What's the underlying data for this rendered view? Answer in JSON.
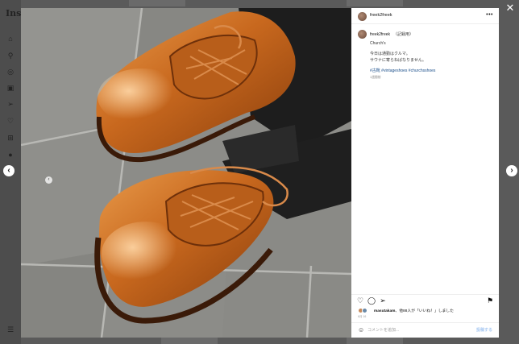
{
  "app": {
    "logo_text": "Insta"
  },
  "sidebar_icons": [
    "home-icon",
    "search-icon",
    "explore-icon",
    "reels-icon",
    "messages-icon",
    "notifications-icon",
    "create-icon",
    "profile-icon",
    "menu-icon"
  ],
  "nav": {
    "close": "✕",
    "prev": "‹",
    "next": "›"
  },
  "post": {
    "username": "freek2freek",
    "more": "•••",
    "caption": {
      "username": "freek2freek",
      "edited": "（記録用）",
      "lines": [
        "Church's",
        "今日は通勤はクルマ。",
        "サウナに寄らねばなりません。"
      ],
      "hashtags": "#古靴 #vintageshoes #churchsshoes",
      "ago": "1週間前"
    },
    "likes": {
      "user": "masutakam",
      "text": "、他88人が「いいね！」しました"
    },
    "date": "6月 16",
    "comment_placeholder": "コメントを追加...",
    "post_label": "投稿する"
  },
  "colors": {
    "hashtag": "#1a4e8a",
    "post_button": "#a9c9f2"
  }
}
